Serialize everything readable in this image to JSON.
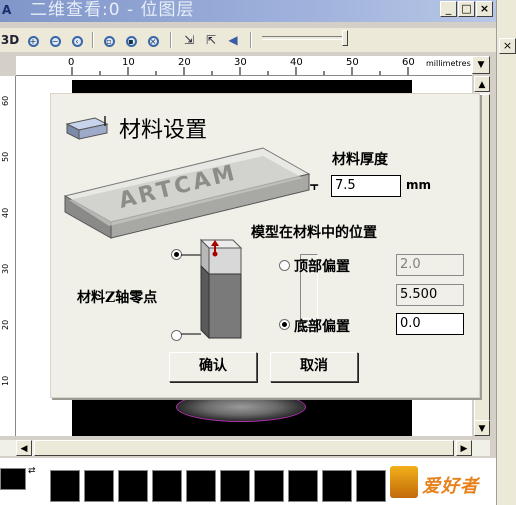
{
  "window": {
    "icon": "A",
    "title": "二维查看:0 - 位图层",
    "minimize_label": "_",
    "maximize_label": "□",
    "close_label": "×"
  },
  "toolbar": {
    "mode_3d_label": "3D",
    "tools": [
      "zoom-in-icon",
      "zoom-out-icon",
      "zoom-previous-icon",
      "zoom-window-icon",
      "zoom-fit-icon",
      "zoom-all-icon",
      "import-icon",
      "export-icon",
      "arrow-left-icon"
    ]
  },
  "ruler": {
    "x_labels": [
      "0",
      "10",
      "20",
      "30",
      "40",
      "50",
      "60"
    ],
    "unit": "millimetres",
    "y_labels": [
      "60",
      "50",
      "40",
      "30",
      "20",
      "10"
    ]
  },
  "dialog": {
    "title": "材料设置",
    "thickness_label": "材料厚度",
    "thickness_value": "7.5",
    "thickness_unit": "mm",
    "z_zero_label": "材料Z轴零点",
    "model_position_label": "模型在材料中的位置",
    "top_offset_label": "顶部偏置",
    "top_offset_value": "2.0",
    "model_height_value": "5.500",
    "bottom_offset_label": "底部偏置",
    "bottom_offset_value": "0.0",
    "z_zero_selected": "top",
    "offset_selected": "bottom",
    "ok_label": "确认",
    "cancel_label": "取消",
    "preview_text": "ARTCAM"
  },
  "palette": {
    "logo_text": "爱好者",
    "swatch_count": 10,
    "primary_color": "#000000"
  }
}
